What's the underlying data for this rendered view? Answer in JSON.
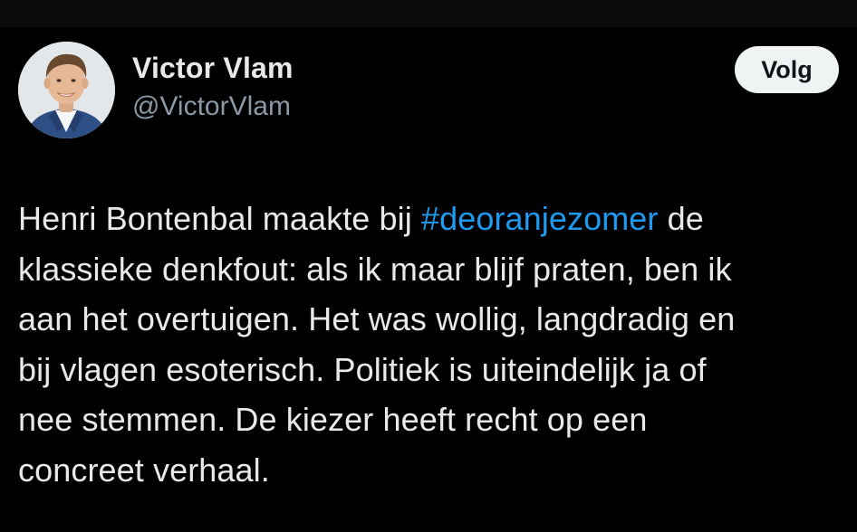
{
  "tweet": {
    "author": {
      "display_name": "Victor Vlam",
      "handle": "@VictorVlam"
    },
    "follow_label": "Volg",
    "text": {
      "line1_before": "Henri Bontenbal maakte bij ",
      "hashtag": "#deoranjezomer",
      "line1_after": " de",
      "line2": "klassieke denkfout: als ik maar blijf praten, ben ik",
      "line3": "aan het overtuigen. Het was wollig, langdradig en",
      "line4": "bij vlagen esoterisch. Politiek is uiteindelijk ja of",
      "line5": "nee stemmen. De kiezer heeft recht op een",
      "line6": "concreet verhaal."
    }
  },
  "colors": {
    "background": "#000000",
    "text": "#e7e9ea",
    "secondary_text": "#8b98a5",
    "link": "#1d9bf0",
    "button_bg": "#eff3f4",
    "button_text": "#0f1419"
  }
}
